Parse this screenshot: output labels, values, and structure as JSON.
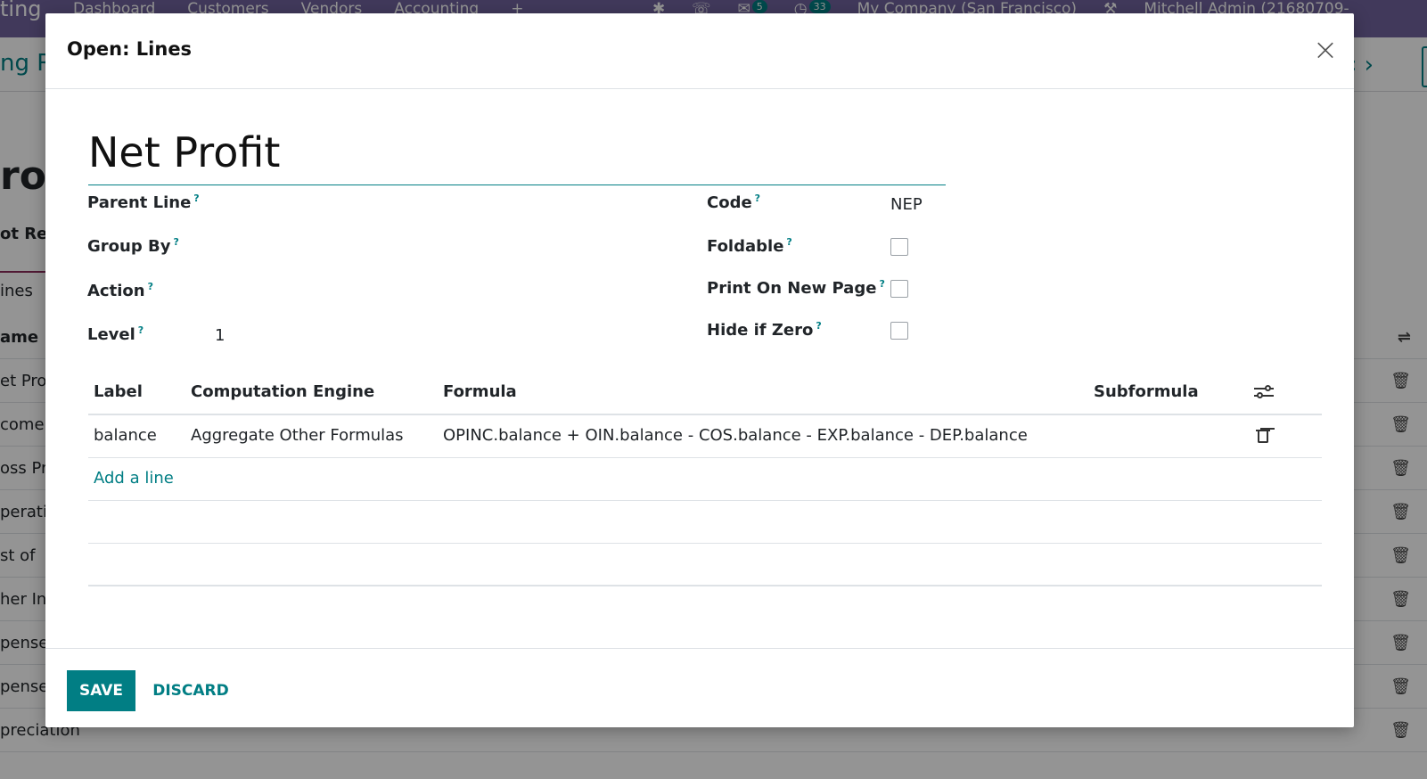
{
  "background": {
    "brand": "ting",
    "menu": [
      "Dashboard",
      "Customers",
      "Vendors",
      "Accounting",
      "+"
    ],
    "messages_count": "5",
    "activities_count": "33",
    "company": "My Company (San Francisco)",
    "user": "Mitchell Admin (21680709-",
    "breadcrumb": "ng Re",
    "pager": "‹ ›",
    "title": "rol",
    "subtitle": "ot Rep",
    "tab": "ines",
    "list_header": "ame",
    "list_rows": [
      "et Pro",
      "come",
      "oss Pr",
      "perati",
      "st of",
      "her In",
      "pense",
      "pense",
      "preciation"
    ]
  },
  "dialog": {
    "title": "Open: Lines",
    "close_glyph": "×",
    "name": "Net Profit",
    "fields": {
      "parent_line_label": "Parent Line",
      "group_by_label": "Group By",
      "action_label": "Action",
      "level_label": "Level",
      "level_value": "1",
      "code_label": "Code",
      "code_value": "NEP",
      "foldable_label": "Foldable",
      "print_on_new_page_label": "Print On New Page",
      "hide_if_zero_label": "Hide if Zero",
      "help_mark": "?"
    },
    "lines_table": {
      "columns": [
        "Label",
        "Computation Engine",
        "Formula",
        "Subformula"
      ],
      "rows": [
        {
          "label": "balance",
          "engine": "Aggregate Other Formulas",
          "formula": "OPINC.balance + OIN.balance - COS.balance - EXP.balance - DEP.balance",
          "subformula": ""
        }
      ],
      "add_line": "Add a line"
    },
    "footer": {
      "save": "SAVE",
      "discard": "DISCARD"
    }
  }
}
